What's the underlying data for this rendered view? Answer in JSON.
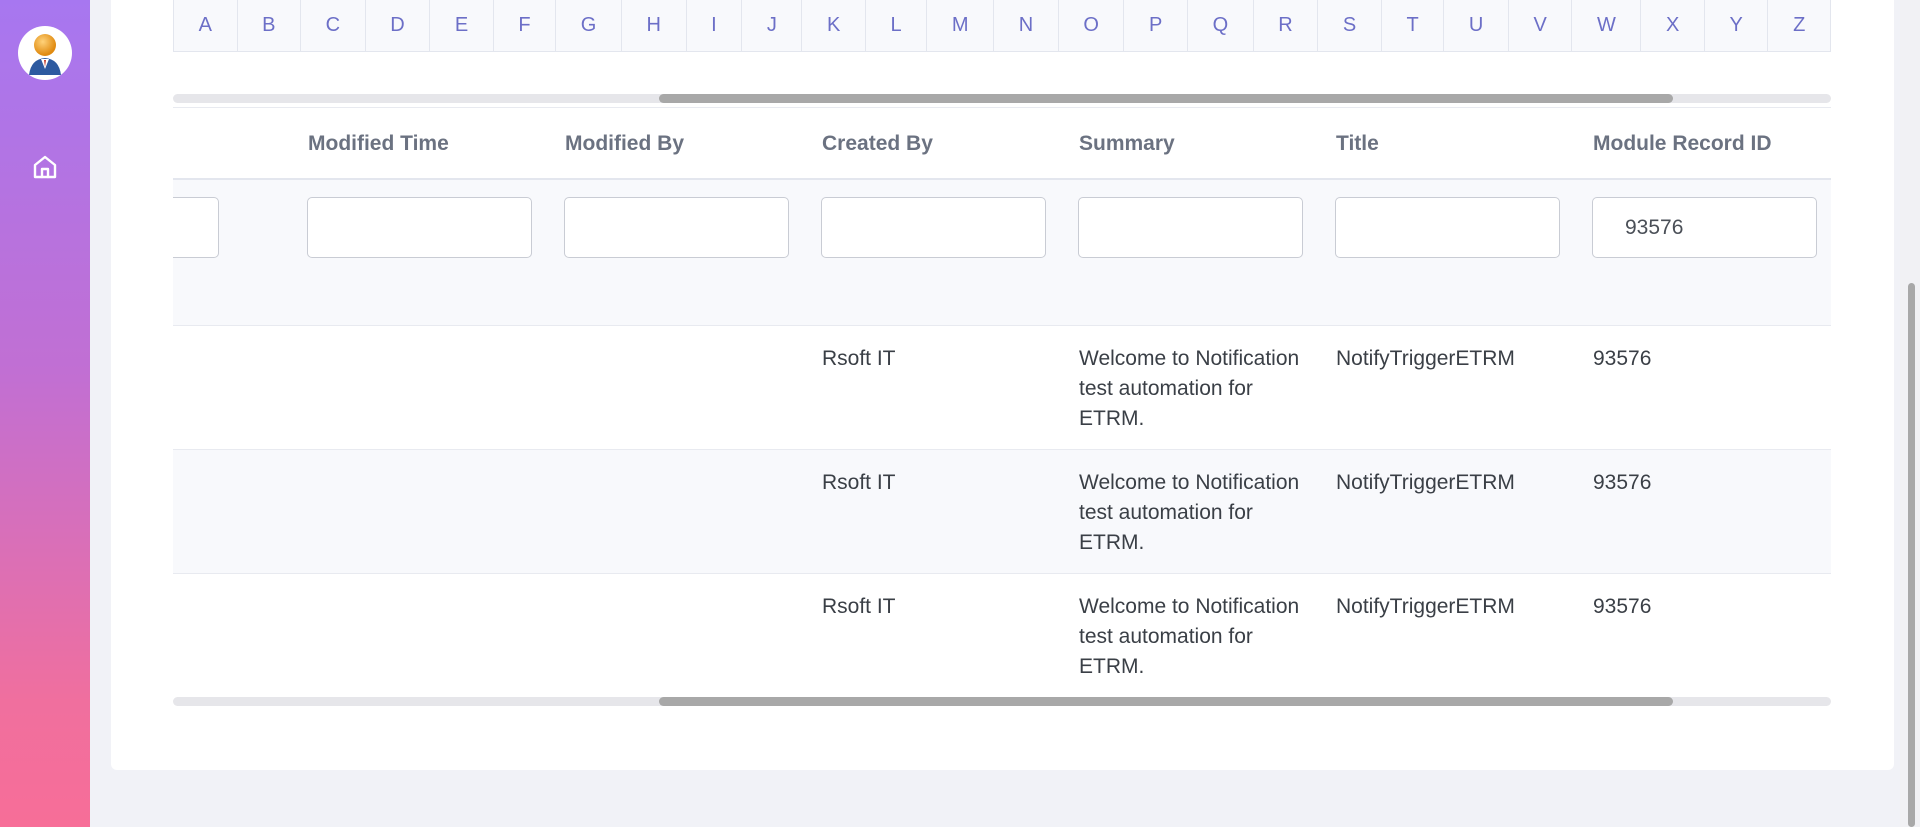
{
  "alphabet": [
    "A",
    "B",
    "C",
    "D",
    "E",
    "F",
    "G",
    "H",
    "I",
    "J",
    "K",
    "L",
    "M",
    "N",
    "O",
    "P",
    "Q",
    "R",
    "S",
    "T",
    "U",
    "V",
    "W",
    "X",
    "Y",
    "Z"
  ],
  "columns": [
    {
      "key": "prev",
      "label": ""
    },
    {
      "key": "modified_time",
      "label": "Modified Time"
    },
    {
      "key": "modified_by",
      "label": "Modified By"
    },
    {
      "key": "created_by",
      "label": "Created By"
    },
    {
      "key": "summary",
      "label": "Summary"
    },
    {
      "key": "title",
      "label": "Title"
    },
    {
      "key": "module_record_id",
      "label": "Module Record ID"
    }
  ],
  "filters": {
    "prev": "",
    "modified_time": "",
    "modified_by": "",
    "created_by": "",
    "summary": "",
    "title": "",
    "module_record_id": "93576"
  },
  "rows": [
    {
      "prev": "",
      "modified_time": "",
      "modified_by": "",
      "created_by": "Rsoft IT",
      "summary": "Welcome to Notification test automation for ETRM.",
      "title": "NotifyTriggerETRM",
      "module_record_id": "93576"
    },
    {
      "prev": "",
      "modified_time": "",
      "modified_by": "",
      "created_by": "Rsoft IT",
      "summary": "Welcome to Notification test automation for ETRM.",
      "title": "NotifyTriggerETRM",
      "module_record_id": "93576"
    },
    {
      "prev": "",
      "modified_time": "",
      "modified_by": "",
      "created_by": "Rsoft IT",
      "summary": "Welcome to Notification test automation for ETRM.",
      "title": "NotifyTriggerETRM",
      "module_record_id": "93576"
    }
  ],
  "icons": {
    "sidebar_home": "home-icon",
    "avatar": "user-avatar-icon"
  },
  "colors": {
    "sidebar_top": "#a777f0",
    "sidebar_bottom": "#f76e98",
    "alphabet_link": "#6c6fc7"
  }
}
